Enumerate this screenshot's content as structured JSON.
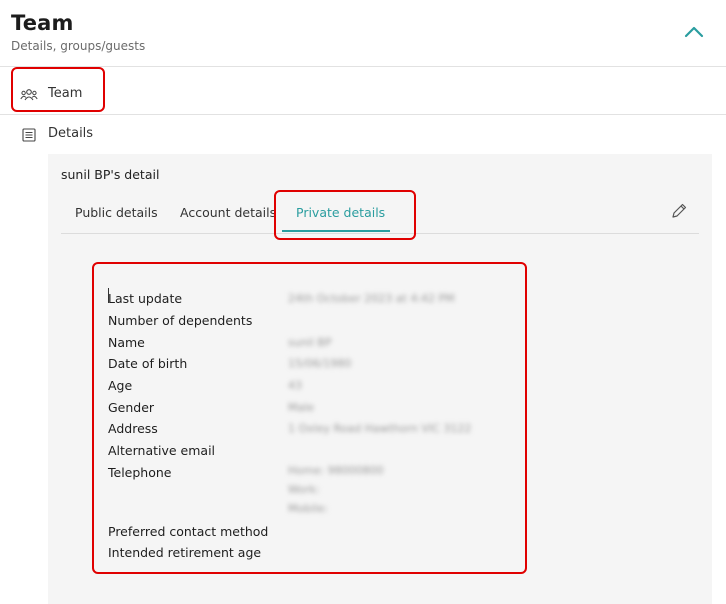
{
  "header": {
    "title": "Team",
    "subtitle": "Details, groups/guests",
    "collapse_icon": "chevron-up-icon",
    "accent_color": "#2a9d9f"
  },
  "nav": {
    "team": {
      "label": "Team",
      "icon": "people-group-icon"
    },
    "details": {
      "label": "Details",
      "icon": "list-icon"
    }
  },
  "panel": {
    "title": "sunil BP's detail",
    "tabs": [
      {
        "label": "Public details",
        "active": false
      },
      {
        "label": "Account details",
        "active": false
      },
      {
        "label": "Private details",
        "active": true
      }
    ],
    "edit_icon": "pencil-icon"
  },
  "private_details": [
    {
      "label": "Last update",
      "value": "24th October 2023 at 4:42 PM"
    },
    {
      "label": "Number of dependents",
      "value": ""
    },
    {
      "label": "Name",
      "value": "sunil BP"
    },
    {
      "label": "Date of birth",
      "value": "15/06/1980"
    },
    {
      "label": "Age",
      "value": "43"
    },
    {
      "label": "Gender",
      "value": "Male"
    },
    {
      "label": "Address",
      "value": "1 Oxley Road Hawthorn VIC 3122"
    },
    {
      "label": "Alternative email",
      "value": ""
    },
    {
      "label": "Telephone",
      "value": "Home: 98000800",
      "value2": "Work:",
      "value3": "Mobile:"
    },
    {
      "label": "Preferred contact method",
      "value": ""
    },
    {
      "label": "Intended retirement age",
      "value": ""
    }
  ]
}
